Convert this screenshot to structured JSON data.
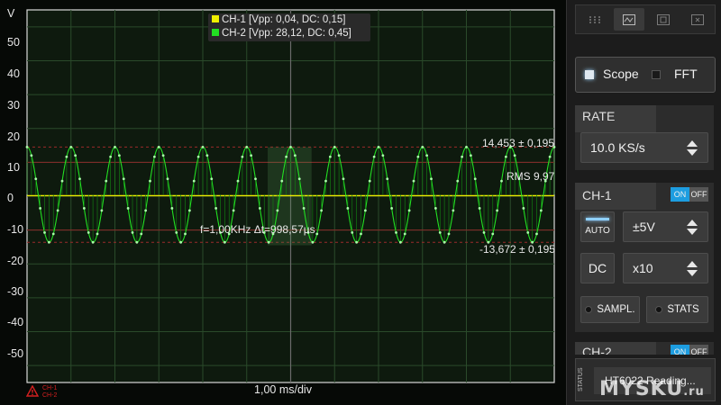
{
  "scope": {
    "y_unit": "V",
    "y_ticks": [
      "50",
      "40",
      "30",
      "20",
      "10",
      "0",
      "-10",
      "-20",
      "-30",
      "-40",
      "-50"
    ],
    "legend": [
      {
        "label": "CH-1 [Vpp: 0,04, DC: 0,15]",
        "color": "#f0f000"
      },
      {
        "label": "CH-2 [Vpp: 28,12, DC: 0,45]",
        "color": "#22e022"
      }
    ],
    "max_label": "14,453 ± 0,195",
    "rms_label": "RMS 9,97",
    "min_label": "-13,672 ± 0,195",
    "freq_label": "f=1,00KHz Δt=998,57µs",
    "timebase": "1,00 ms/div",
    "warn_channels": [
      "CH-1",
      "CH-2"
    ],
    "waveform": {
      "frequency_khz": 1.0,
      "amplitude_v": 14.06,
      "offset_v": 0.45,
      "ymin": -55,
      "ymax": 55
    }
  },
  "panel": {
    "tabs": [
      "dots-grid-icon",
      "waveform-icon",
      "image-icon",
      "close-box-icon"
    ],
    "modes": {
      "scope": "Scope",
      "fft": "FFT"
    },
    "rate": {
      "title": "RATE",
      "value": "10.0 KS/s"
    },
    "ch1": {
      "title": "CH-1",
      "on": "ON",
      "off": "OFF",
      "auto": "AUTO",
      "volt": "±5V",
      "coupling": "DC",
      "probe": "x10",
      "sampl": "SAMPL.",
      "stats": "STATS"
    },
    "ch2": {
      "title": "CH-2",
      "on": "ON",
      "off": "OFF"
    },
    "status": {
      "label": "STATUS",
      "text": "HT6022 Reading..."
    }
  },
  "watermark": {
    "main": "MYSKU",
    "suffix": ".ru"
  },
  "colors": {
    "ch1": "#f0f000",
    "ch2": "#22e022",
    "accent": "#1d9de0",
    "warning": "#d42020"
  }
}
